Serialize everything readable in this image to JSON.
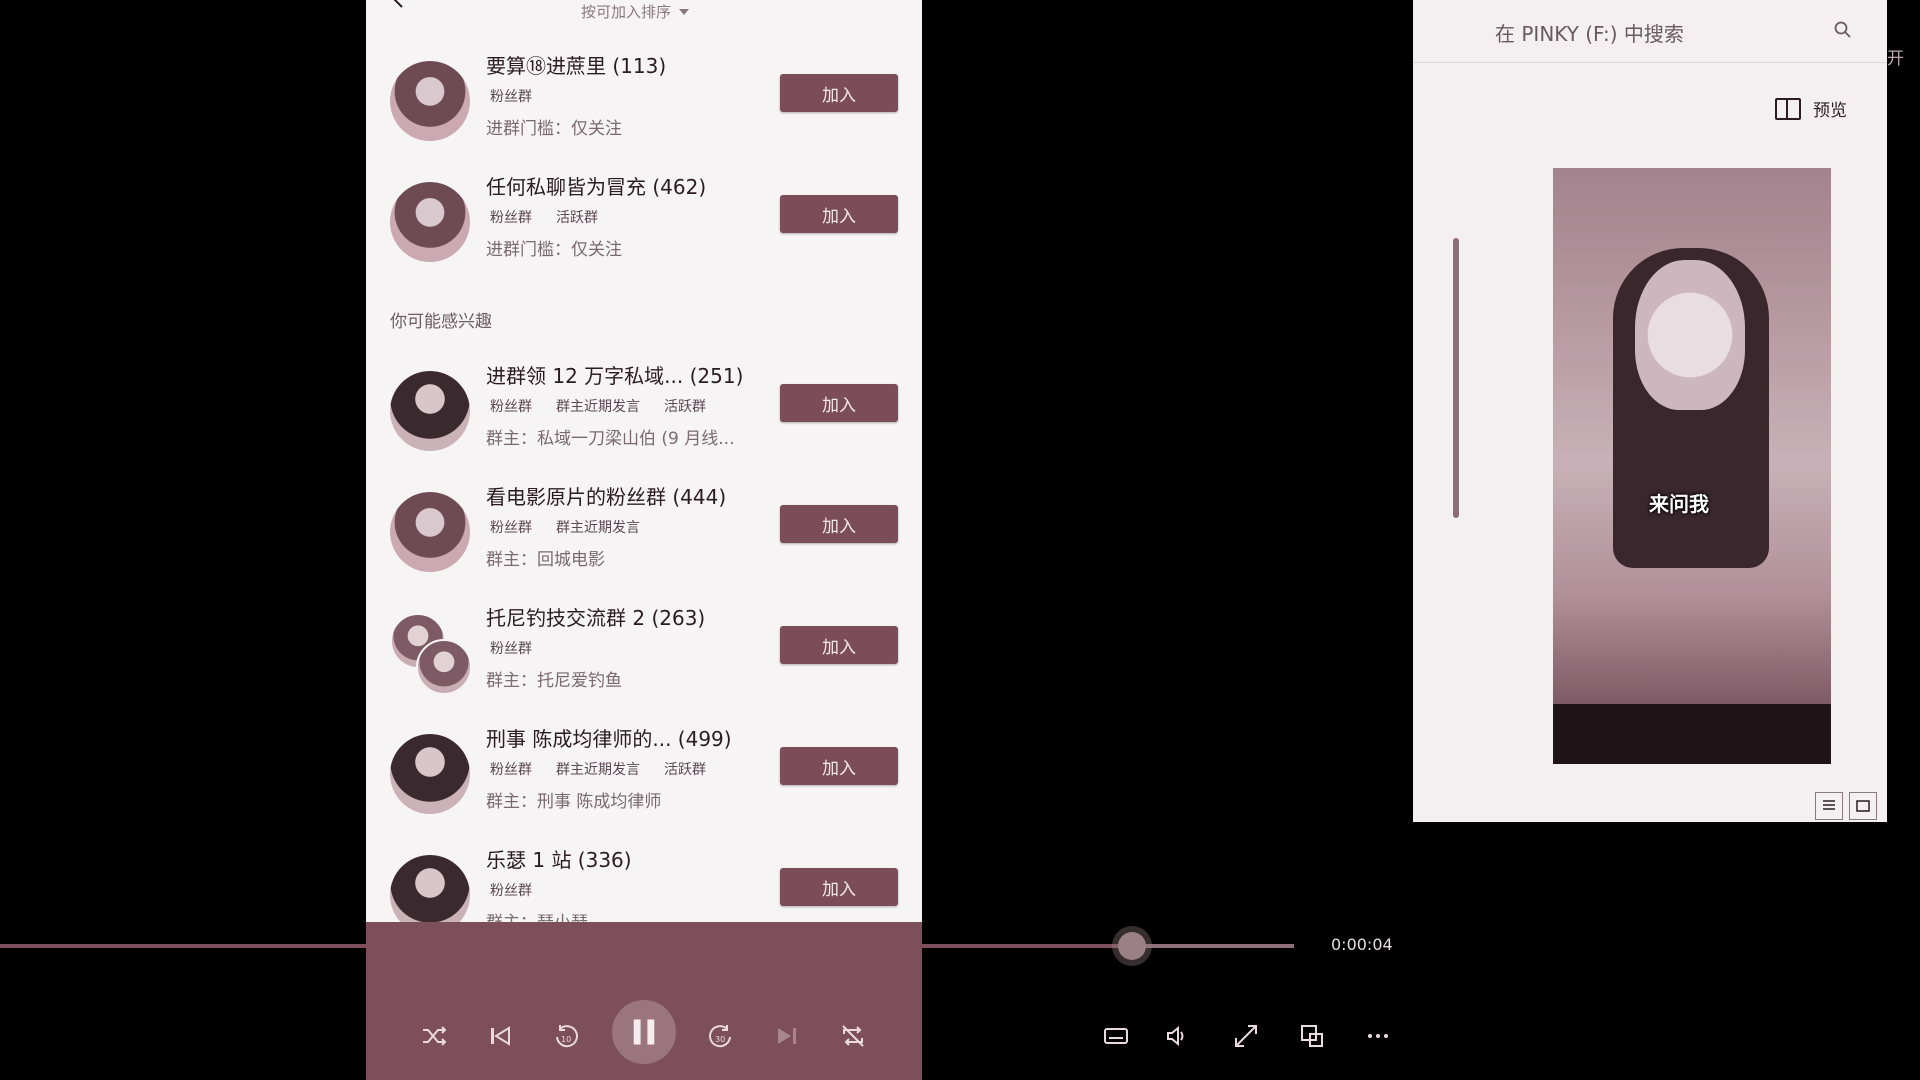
{
  "phone": {
    "sort_label": "按可加入排序",
    "section_label": "你可能感兴趣",
    "join_label": "加入",
    "groups": [
      {
        "title": "要算⑱进蔗里 (113)",
        "tags": [
          "粉丝群"
        ],
        "sub": "进群门槛：仅关注"
      },
      {
        "title": "任何私聊皆为冒充 (462)",
        "tags": [
          "粉丝群",
          "活跃群"
        ],
        "sub": "进群门槛：仅关注"
      },
      {
        "title": "进群领 12 万字私域...  (251)",
        "tags": [
          "粉丝群",
          "群主近期发言",
          "活跃群"
        ],
        "sub": "群主：私域一刀梁山伯 (9 月线..."
      },
      {
        "title": "看电影原片的粉丝群 (444)",
        "tags": [
          "粉丝群",
          "群主近期发言"
        ],
        "sub": "群主：回城电影"
      },
      {
        "title": "托尼钓技交流群 2 (263)",
        "tags": [
          "粉丝群"
        ],
        "sub": "群主：托尼爱钓鱼"
      },
      {
        "title": "刑事 陈成均律师的...  (499)",
        "tags": [
          "粉丝群",
          "群主近期发言",
          "活跃群"
        ],
        "sub": "群主：刑事 陈成均律师"
      },
      {
        "title": "乐瑟 1 站 (336)",
        "tags": [
          "粉丝群"
        ],
        "sub": "群主：瑟小瑟"
      }
    ]
  },
  "player": {
    "time": "0:00:04",
    "progress": 0.875,
    "controls": [
      "shuffle-icon",
      "previous-icon",
      "rewind-10-icon",
      "pause-icon",
      "forward-30-icon",
      "next-icon",
      "repeat-off-icon"
    ],
    "right_controls": [
      "subtitles-icon",
      "volume-icon",
      "fullscreen-icon",
      "mini-player-icon",
      "more-icon"
    ]
  },
  "explorer": {
    "search_placeholder": "在 PINKY (F:) 中搜索",
    "open_label": "开",
    "preview_label": "预览",
    "preview_caption": "来问我"
  },
  "colors": {
    "accent": "#7b4d59",
    "background": "#000000",
    "list_bg": "#f7f4f5"
  }
}
